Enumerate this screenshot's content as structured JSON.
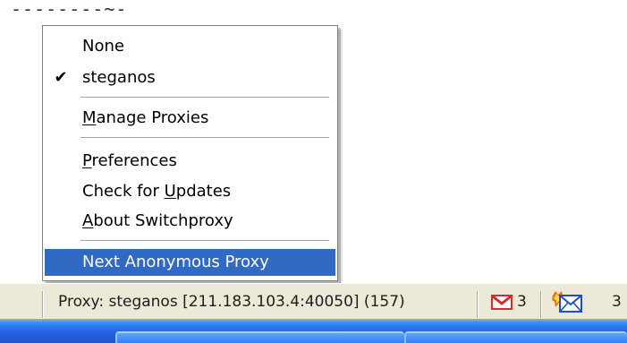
{
  "window": {
    "top_text": "--------~-"
  },
  "menu": {
    "items": [
      {
        "label": "None",
        "checked": false,
        "mnemonic": ""
      },
      {
        "label": "steganos",
        "checked": true,
        "mnemonic": ""
      },
      {
        "label_pre": "",
        "label_mn": "M",
        "label_post": "anage Proxies"
      },
      {
        "label_pre": "",
        "label_mn": "P",
        "label_post": "references"
      },
      {
        "label_pre": "Check for ",
        "label_mn": "U",
        "label_post": "pdates"
      },
      {
        "label_pre": "",
        "label_mn": "A",
        "label_post": "bout Switchproxy"
      },
      {
        "label": "Next Anonymous Proxy",
        "selected": true
      }
    ],
    "check_glyph": "✔"
  },
  "statusbar": {
    "proxy_text": "Proxy: steganos [211.183.103.4:40050] (157)",
    "gmail_count": "3",
    "mail_count": "3",
    "icons": {
      "gmail": "gmail-icon",
      "mail": "new-mail-icon"
    }
  },
  "colors": {
    "menu_selection": "#316ac5",
    "statusbar_bg": "#ece9d8",
    "taskbar_blue": "#245edb",
    "gmail_red": "#d62b2b"
  }
}
